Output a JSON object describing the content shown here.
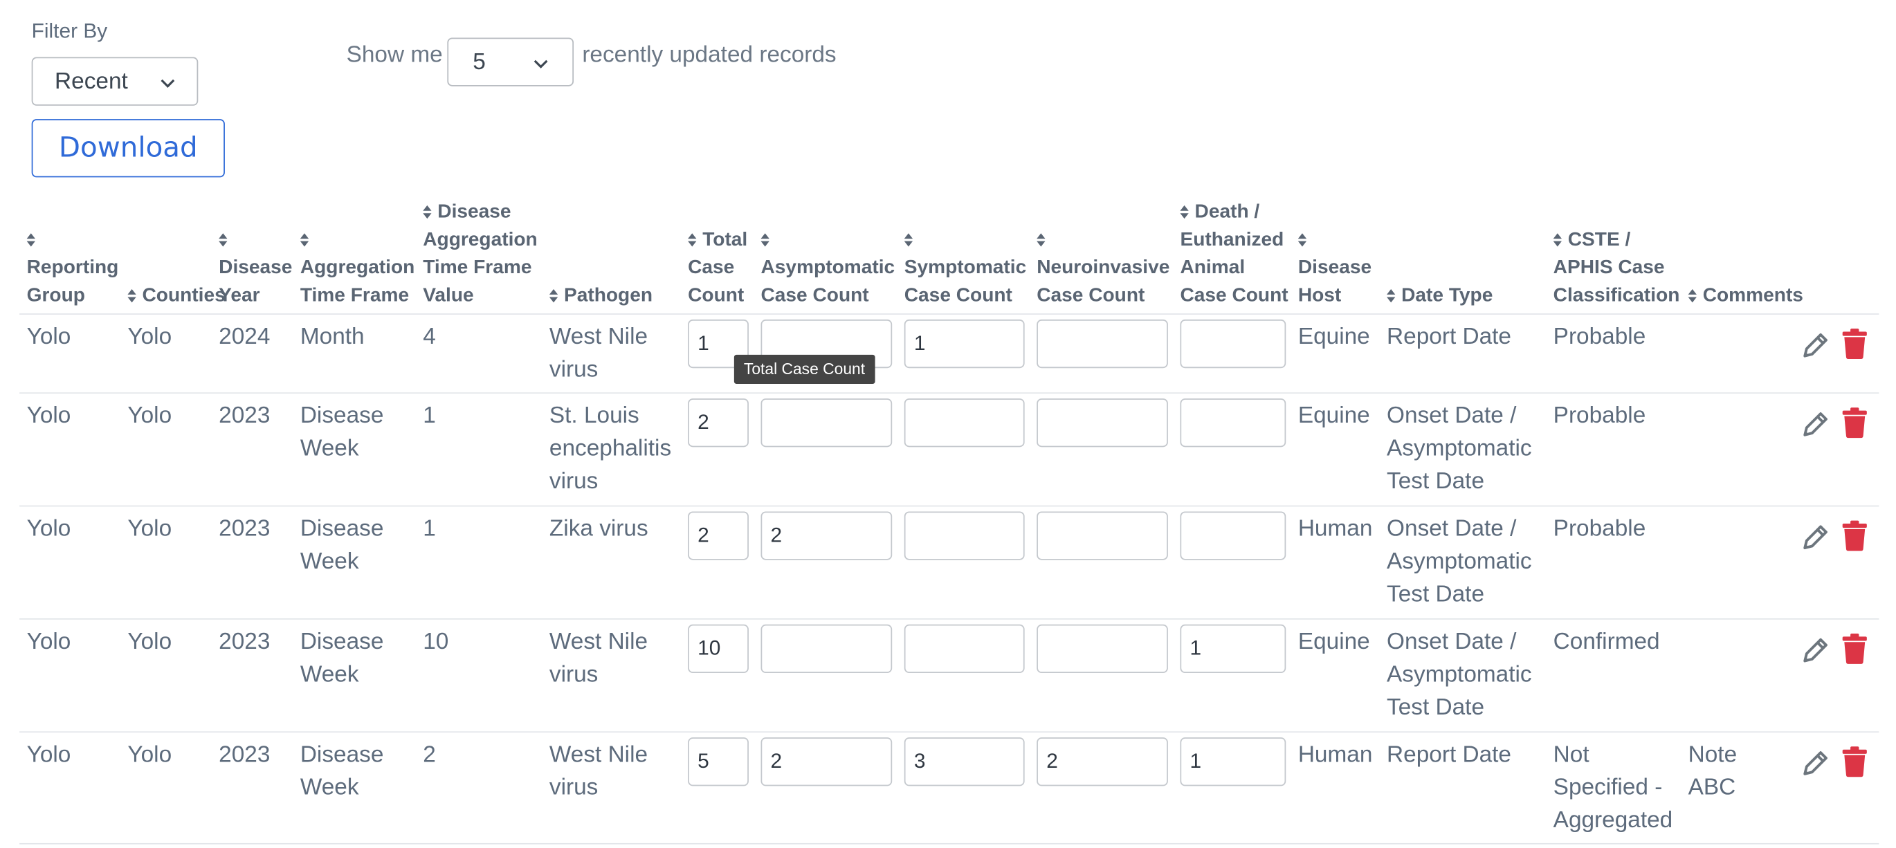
{
  "filter": {
    "label": "Filter By",
    "selected": "Recent"
  },
  "show": {
    "prefix": "Show me",
    "selected": "5",
    "suffix": "recently updated records"
  },
  "download_label": "Download",
  "colors": {
    "accent": "#2f6ad8",
    "delete": "#dc3545",
    "edit": "#6c757d",
    "text": "#5d6b7c"
  },
  "icons": {
    "sort": "sort-icon",
    "edit": "pencil-icon",
    "delete": "trash-icon",
    "dropdown": "chevron-down-icon"
  },
  "columns": [
    "Reporting Group",
    "Counties",
    "Disease Year",
    "Aggregation Time Frame",
    "Disease Aggregation Time Frame Value",
    "Pathogen",
    "Total Case Count",
    "Asymptomatic Case Count",
    "Symptomatic Case Count",
    "Neuroinvasive Case Count",
    "Death / Euthanized Animal Case Count",
    "Disease Host",
    "Date Type",
    "CSTE / APHIS Case Classification",
    "Comments"
  ],
  "rows": [
    {
      "group": "Yolo",
      "counties": "Yolo",
      "year": "2024",
      "timeframe": "Month",
      "value": "4",
      "pathogen": "West Nile virus",
      "total": "1",
      "asym": "",
      "sym": "1",
      "neuro": "",
      "death": "",
      "host": "Equine",
      "datetype": "Report Date",
      "classification": "Probable",
      "comments": ""
    },
    {
      "group": "Yolo",
      "counties": "Yolo",
      "year": "2023",
      "timeframe": "Disease Week",
      "value": "1",
      "pathogen": "St. Louis encephalitis virus",
      "total": "2",
      "asym": "",
      "sym": "",
      "neuro": "",
      "death": "",
      "host": "Equine",
      "datetype": "Onset Date / Asymptomatic Test Date",
      "classification": "Probable",
      "comments": ""
    },
    {
      "group": "Yolo",
      "counties": "Yolo",
      "year": "2023",
      "timeframe": "Disease Week",
      "value": "1",
      "pathogen": "Zika virus",
      "total": "2",
      "asym": "2",
      "sym": "",
      "neuro": "",
      "death": "",
      "host": "Human",
      "datetype": "Onset Date / Asymptomatic Test Date",
      "classification": "Probable",
      "comments": ""
    },
    {
      "group": "Yolo",
      "counties": "Yolo",
      "year": "2023",
      "timeframe": "Disease Week",
      "value": "10",
      "pathogen": "West Nile virus",
      "total": "10",
      "asym": "",
      "sym": "",
      "neuro": "",
      "death": "1",
      "host": "Equine",
      "datetype": "Onset Date / Asymptomatic Test Date",
      "classification": "Confirmed",
      "comments": ""
    },
    {
      "group": "Yolo",
      "counties": "Yolo",
      "year": "2023",
      "timeframe": "Disease Week",
      "value": "2",
      "pathogen": "West Nile virus",
      "total": "5",
      "asym": "2",
      "sym": "3",
      "neuro": "2",
      "death": "1",
      "host": "Human",
      "datetype": "Report Date",
      "classification": "Not Specified - Aggregated",
      "comments": "Note ABC"
    }
  ],
  "tooltip": "Total Case Count"
}
